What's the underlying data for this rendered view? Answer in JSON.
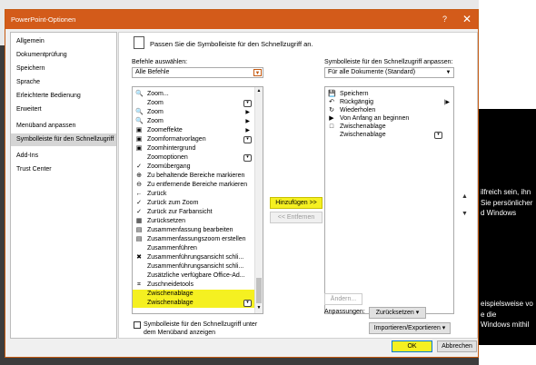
{
  "window": {
    "title": "PowerPoint-Optionen",
    "help": "?",
    "close": "✕"
  },
  "nav": {
    "items": [
      "Allgemein",
      "Dokumentprüfung",
      "Speichern",
      "Sprache",
      "Erleichterte Bedienung",
      "Erweitert",
      "Menüband anpassen",
      "Symbolleiste für den Schnellzugriff",
      "Add-Ins",
      "Trust Center"
    ],
    "selected_index": 7
  },
  "header": {
    "text": "Passen Sie die Symbolleiste für den Schnellzugriff an."
  },
  "left": {
    "label": "Befehle auswählen:",
    "dropdown_value": "Alle Befehle",
    "items": [
      {
        "label": "Zoom...",
        "icon": "🔍",
        "extra": ""
      },
      {
        "label": "Zoom",
        "icon": "",
        "extra": "sub"
      },
      {
        "label": "Zoom",
        "icon": "🔍",
        "extra": "arrow"
      },
      {
        "label": "Zoom",
        "icon": "🔍",
        "extra": "arrow"
      },
      {
        "label": "Zoomeffekte",
        "icon": "▣",
        "extra": "arrow"
      },
      {
        "label": "Zoomformatvorlagen",
        "icon": "▣",
        "extra": "sub"
      },
      {
        "label": "Zoomhintergrund",
        "icon": "▣",
        "extra": ""
      },
      {
        "label": "Zoomoptionen",
        "icon": "",
        "extra": "sub"
      },
      {
        "label": "Zoomübergang",
        "icon": "✓",
        "extra": ""
      },
      {
        "label": "Zu behaltende Bereiche markieren",
        "icon": "⊕",
        "extra": ""
      },
      {
        "label": "Zu entfernende Bereiche markieren",
        "icon": "⊖",
        "extra": ""
      },
      {
        "label": "Zurück",
        "icon": "←",
        "extra": ""
      },
      {
        "label": "Zurück zum Zoom",
        "icon": "✓",
        "extra": ""
      },
      {
        "label": "Zurück zur Farbansicht",
        "icon": "✓",
        "extra": ""
      },
      {
        "label": "Zurücksetzen",
        "icon": "▦",
        "extra": ""
      },
      {
        "label": "Zusammenfassung bearbeiten",
        "icon": "▤",
        "extra": ""
      },
      {
        "label": "Zusammenfassungszoom erstellen",
        "icon": "▤",
        "extra": ""
      },
      {
        "label": "Zusammenführen",
        "icon": "",
        "extra": ""
      },
      {
        "label": "Zusammenführungsansicht schli...",
        "icon": "✖",
        "extra": ""
      },
      {
        "label": "Zusammenführungsansicht schli...",
        "icon": "",
        "extra": ""
      },
      {
        "label": "Zusätzliche verfügbare Office-Ad...",
        "icon": "",
        "extra": ""
      },
      {
        "label": "Zuschneidetools",
        "icon": "⌗",
        "extra": ""
      },
      {
        "label": "Zwischenablage",
        "icon": "",
        "extra": "",
        "highlight": true
      },
      {
        "label": "Zwischenablage",
        "icon": "",
        "extra": "sub",
        "highlight": true
      }
    ],
    "checkbox_label_1": "Symbolleiste für den Schnellzugriff unter",
    "checkbox_label_2": "dem Menüband anzeigen"
  },
  "middle": {
    "add_button": "Hinzufügen >>",
    "remove_button": "<< Entfernen"
  },
  "right": {
    "label": "Symbolleiste für den Schnellzugriff anpassen:",
    "dropdown_value": "Für alle Dokumente (Standard)",
    "items": [
      {
        "label": "Speichern",
        "icon": "💾",
        "extra": ""
      },
      {
        "label": "Rückgängig",
        "icon": "↶",
        "extra": "bar"
      },
      {
        "label": "Wiederholen",
        "icon": "↻",
        "extra": ""
      },
      {
        "label": "Von Anfang an beginnen",
        "icon": "▶",
        "extra": ""
      },
      {
        "label": "Zwischenablage",
        "icon": "□",
        "extra": ""
      },
      {
        "label": "Zwischenablage",
        "icon": "",
        "extra": "sub"
      }
    ],
    "modify_button": "Ändern...",
    "customizations_label": "Anpassungen:",
    "reset_button": "Zurücksetzen ▾",
    "import_export_button": "Importieren/Exportieren ▾"
  },
  "footer": {
    "ok": "OK",
    "cancel": "Abbrechen"
  },
  "background": {
    "lines": [
      "ilfreich sein, ihn",
      "Sie persönlicher",
      "d Windows",
      "eispielsweise vo",
      "e die",
      "Windows mithil"
    ]
  }
}
